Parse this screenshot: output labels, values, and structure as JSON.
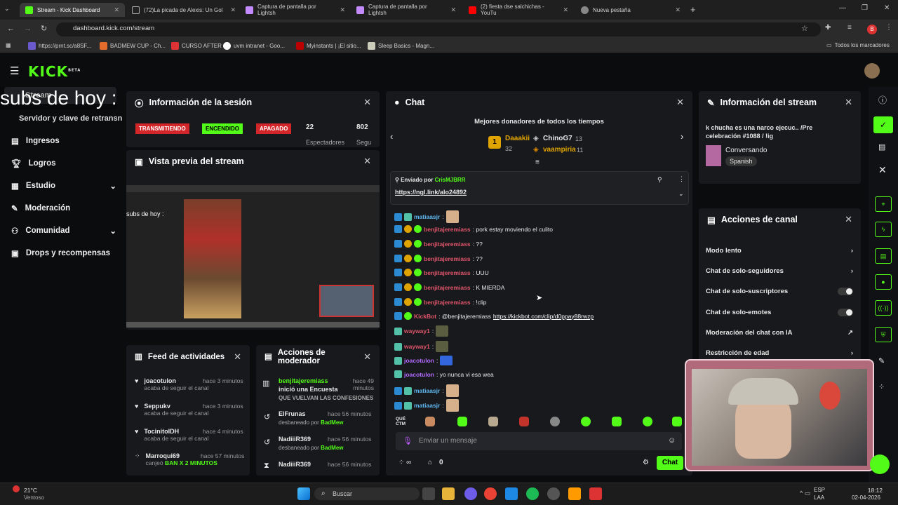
{
  "browser": {
    "tabs": [
      {
        "label": "Stream - Kick Dashboard",
        "active": true
      },
      {
        "label": "(72)La picada de Alexis: Un Gol"
      },
      {
        "label": "Captura de pantalla por Lightsh"
      },
      {
        "label": "Captura de pantalla por Lightsh"
      },
      {
        "label": "(2) fiesta dse salchichas - YouTu"
      },
      {
        "label": "Nueva pestaña"
      }
    ],
    "url": "dashboard.kick.com/stream",
    "profile_initial": "B",
    "bookmarks": [
      "https://prnt.sc/a8SF...",
      "BADMEW CUP - Ch...",
      "CURSO AFTER",
      "uvm intranet - Goo...",
      "Myinstants | ¡El sitio...",
      "Sleep Basics - Magn..."
    ],
    "all_bookmarks": "Todos los marcadores"
  },
  "app": {
    "logo": "KICK",
    "logo_sup": "BETA",
    "overlay_text": "subs de hoy :",
    "stream_label": "Stream",
    "server_key": "Servidor y clave de retransn",
    "nav": [
      {
        "label": "Ingresos",
        "icon": "dollar-icon"
      },
      {
        "label": "Logros",
        "icon": "trophy-icon"
      },
      {
        "label": "Estudio",
        "icon": "studio-icon"
      },
      {
        "label": "Moderación",
        "icon": "wrench-icon"
      },
      {
        "label": "Comunidad",
        "icon": "community-icon"
      },
      {
        "label": "Drops y recompensas",
        "icon": "gift-icon"
      }
    ]
  },
  "session": {
    "title": "Información de la sesión",
    "badges": [
      "TRANSMITIENDO",
      "ENCENDIDO",
      "APAGADO"
    ],
    "viewers": "22",
    "viewers_label": "Espectadores",
    "followers": "802",
    "followers_label": "Segu"
  },
  "preview": {
    "title": "Vista previa del stream",
    "overlay": "subs de hoy :"
  },
  "feed": {
    "title": "Feed de actividades",
    "items": [
      {
        "user": "joacotulon",
        "time": "hace 3 minutos",
        "text": "acaba de seguir el canal"
      },
      {
        "user": "Seppukv",
        "time": "hace 3 minutos",
        "text": "acaba de seguir el canal"
      },
      {
        "user": "TocinitoIDH",
        "time": "hace 4 minutos",
        "text": "acaba de seguir el canal"
      },
      {
        "user": "Marroqui69",
        "time": "hace 57 minutos",
        "text": "canjeó",
        "extra": "BAN X 2 MINUTOS"
      }
    ]
  },
  "modactions": {
    "title": "Acciones de moderador",
    "items": [
      {
        "user": "benjitajeremiass",
        "text": "inició una Encuesta",
        "time": "hace 49 minutos",
        "sub": "QUE VUELVAN LAS CONFESIONES"
      },
      {
        "user": "ElFrunas",
        "text": "desbaneado por",
        "by": "BadMew",
        "time": "hace 56 minutos"
      },
      {
        "user": "NadiiiR369",
        "text": "desbaneado por",
        "by": "BadMew",
        "time": "hace 56 minutos"
      },
      {
        "user": "NadiiiR369",
        "text": "",
        "time": "hace 56 minutos"
      }
    ]
  },
  "chat": {
    "title": "Chat",
    "top_title": "Mejores donadores de todos los tiempos",
    "donors": [
      {
        "name": "Daaakii",
        "amount": "32",
        "rank": "1"
      },
      {
        "name": "ChinoG7",
        "amount": "13"
      },
      {
        "name": "vaampiria",
        "amount": "11"
      }
    ],
    "pinned_by_label": "Enviado por",
    "pinned_by": "CrisMJBRR",
    "pinned_link": "https://ngl.link/alo24892",
    "messages": [
      {
        "user": "matiaasjr",
        "text": ":",
        "color": "#5fb8f0"
      },
      {
        "user": "benjitajeremiass",
        "text": ": pork estay moviendo el culito",
        "color": "#e0556a"
      },
      {
        "user": "benjitajeremiass",
        "text": ": ??",
        "color": "#e0556a"
      },
      {
        "user": "benjitajeremiass",
        "text": ": ??",
        "color": "#e0556a"
      },
      {
        "user": "benjitajeremiass",
        "text": ": UUU",
        "color": "#e0556a"
      },
      {
        "user": "benjitajeremiass",
        "text": ": K MIERDA",
        "color": "#e0556a"
      },
      {
        "user": "benjitajeremiass",
        "text": ": !clip",
        "color": "#e0556a"
      },
      {
        "user": "KickBot",
        "text": ": @benjitajeremiass",
        "link": "https://kickbot.com/clip/d0ppay88rwzp",
        "color": "#e0556a"
      },
      {
        "user": "wayway1",
        "text": ":",
        "color": "#e0556a"
      },
      {
        "user": "wayway1",
        "text": ":",
        "color": "#e0556a"
      },
      {
        "user": "joacotulon",
        "text": ":",
        "color": "#b26bff"
      },
      {
        "user": "joacotulon",
        "text": ": yo nunca vi esa wea",
        "color": "#b26bff"
      },
      {
        "user": "matiaasjr",
        "text": ":",
        "color": "#5fb8f0"
      },
      {
        "user": "matiaasjr",
        "text": ":",
        "color": "#5fb8f0"
      }
    ],
    "emote_first": "QUÉ CTM",
    "input_placeholder": "Enviar un mensaje",
    "points": "0",
    "send_label": "Chat"
  },
  "streaminfo": {
    "title": "Información del stream",
    "stream_title": "k chucha es una narco ejecuc.. /Pre celebración #1088 / !ig",
    "category": "Conversando",
    "language": "Spanish"
  },
  "channel": {
    "title": "Acciones de canal",
    "rows": [
      "Modo lento",
      "Chat de solo-seguidores",
      "Chat de solo-suscriptores",
      "Chat de solo-emotes",
      "Moderación del chat con IA",
      "Restricción de edad"
    ]
  },
  "taskbar": {
    "weather_temp": "21°C",
    "weather_text": "Ventoso",
    "search": "Buscar",
    "lang": "ESP",
    "lang2": "LAA",
    "time": "18:12",
    "date": "02-04-2026"
  }
}
